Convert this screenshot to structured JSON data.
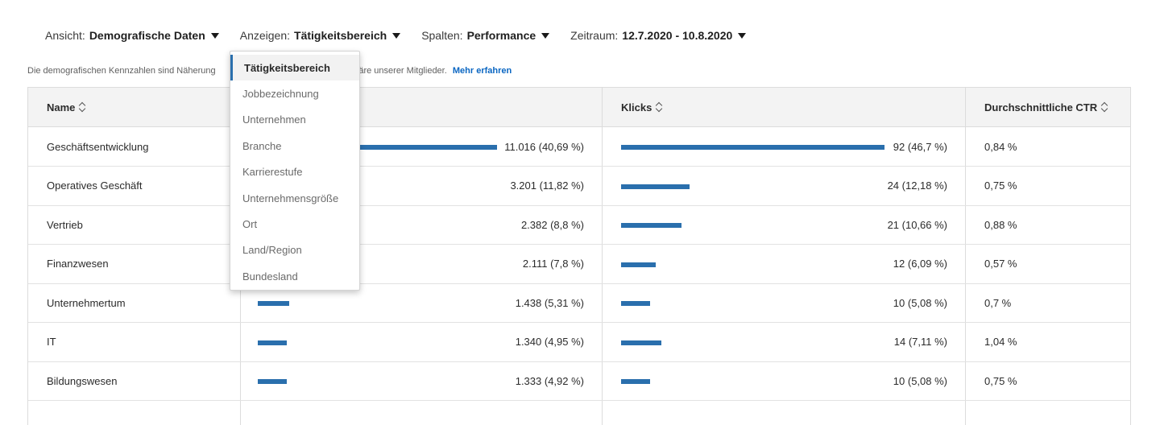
{
  "filters": [
    {
      "label": "Ansicht:",
      "value": "Demografische Daten"
    },
    {
      "label": "Anzeigen:",
      "value": "Tätigkeitsbereich"
    },
    {
      "label": "Spalten:",
      "value": "Performance"
    },
    {
      "label": "Zeitraum:",
      "value": "12.7.2020 - 10.8.2020"
    }
  ],
  "note": {
    "text_before": "Die demografischen Kennzahlen sind Näherung",
    "text_after": "sphäre unserer Mitglieder.",
    "link": "Mehr erfahren"
  },
  "table": {
    "headers": {
      "name": "Name",
      "klicks": "Klicks",
      "ctr": "Durchschnittliche CTR"
    },
    "rows": [
      {
        "name": "Geschäftsentwicklung",
        "impressions": "11.016 (40,69 %)",
        "impressions_share": 40.69,
        "klicks": "92 (46,7 %)",
        "klicks_share": 46.7,
        "ctr": "0,84 %"
      },
      {
        "name": "Operatives Geschäft",
        "impressions": "3.201 (11,82 %)",
        "impressions_share": 11.82,
        "klicks": "24 (12,18 %)",
        "klicks_share": 12.18,
        "ctr": "0,75 %"
      },
      {
        "name": "Vertrieb",
        "impressions": "2.382 (8,8 %)",
        "impressions_share": 8.8,
        "klicks": "21 (10,66 %)",
        "klicks_share": 10.66,
        "ctr": "0,88 %"
      },
      {
        "name": "Finanzwesen",
        "impressions": "2.111 (7,8 %)",
        "impressions_share": 7.8,
        "klicks": "12 (6,09 %)",
        "klicks_share": 6.09,
        "ctr": "0,57 %"
      },
      {
        "name": "Unternehmertum",
        "impressions": "1.438 (5,31 %)",
        "impressions_share": 5.31,
        "klicks": "10 (5,08 %)",
        "klicks_share": 5.08,
        "ctr": "0,7 %"
      },
      {
        "name": "IT",
        "impressions": "1.340 (4,95 %)",
        "impressions_share": 4.95,
        "klicks": "14 (7,11 %)",
        "klicks_share": 7.11,
        "ctr": "1,04 %"
      },
      {
        "name": "Bildungswesen",
        "impressions": "1.333 (4,92 %)",
        "impressions_share": 4.92,
        "klicks": "10 (5,08 %)",
        "klicks_share": 5.08,
        "ctr": "0,75 %"
      }
    ]
  },
  "dropdown": {
    "selected": "Tätigkeitsbereich",
    "items": [
      "Tätigkeitsbereich",
      "Jobbezeichnung",
      "Unternehmen",
      "Branche",
      "Karrierestufe",
      "Unternehmensgröße",
      "Ort",
      "Land/Region",
      "Bundesland"
    ]
  },
  "colors": {
    "bar": "#2a6fad",
    "link": "#0a66c2",
    "header_bg": "#f3f3f3"
  }
}
